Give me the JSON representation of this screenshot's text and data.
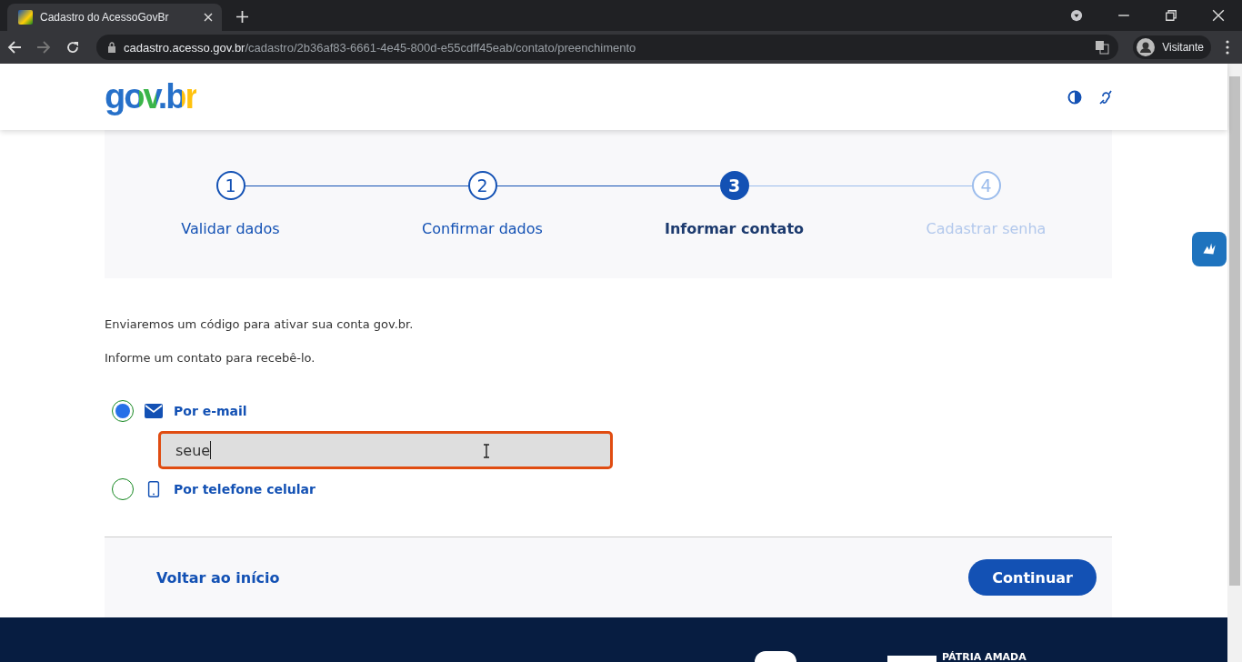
{
  "browser": {
    "tab_title": "Cadastro do AcessoGovBr",
    "url_host": "cadastro.acesso.gov.br",
    "url_path": "/cadastro/2b36af83-6661-4e45-800d-e55cdff45eab/contato/preenchimento",
    "profile": "Visitante"
  },
  "header": {
    "logo": "gov.br"
  },
  "steps": [
    {
      "number": "1",
      "label": "Validar dados",
      "selected": false,
      "disabled": false
    },
    {
      "number": "2",
      "label": "Confirmar dados",
      "selected": false,
      "disabled": false
    },
    {
      "number": "3",
      "label": "Informar contato",
      "selected": true,
      "disabled": false
    },
    {
      "number": "4",
      "label": "Cadastrar senha",
      "selected": false,
      "disabled": true
    }
  ],
  "intro": [
    "Enviaremos um código para ativar sua conta gov.br.",
    "Informe um contato para recebê-lo."
  ],
  "options": [
    {
      "kind": "email",
      "label": "Por e-mail",
      "selected": true,
      "value": "seue"
    },
    {
      "kind": "phone",
      "label": "Por telefone celular",
      "selected": false
    }
  ],
  "actions": {
    "back": "Voltar ao início",
    "continue": "Continuar"
  },
  "footer": {
    "motto": "PÁTRIA AMADA"
  }
}
